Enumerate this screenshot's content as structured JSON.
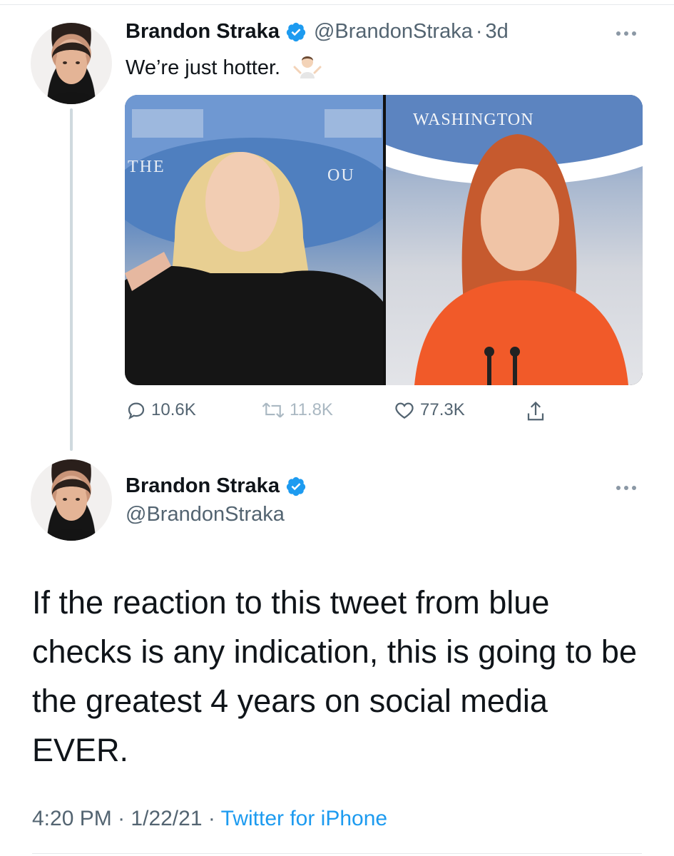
{
  "tweet1": {
    "display_name": "Brandon Straka",
    "handle": "@BrandonStraka",
    "separator": "·",
    "time_ago": "3d",
    "text": "We’re just hotter.",
    "media": {
      "labels": [
        "WASHINGTON",
        "THE",
        "OU"
      ]
    },
    "actions": {
      "replies": "10.6K",
      "retweets": "11.8K",
      "likes": "77.3K"
    }
  },
  "tweet2": {
    "display_name": "Brandon Straka",
    "handle": "@BrandonStraka",
    "text": "If the reaction to this tweet from blue checks is any indication, this is going to be the greatest 4 years on social media EVER.",
    "time": "4:20 PM",
    "separator": "·",
    "date": "1/22/21",
    "source": "Twitter for iPhone"
  },
  "colors": {
    "verified": "#1d9bf0",
    "muted": "#536471",
    "link": "#1d9bf0",
    "thread_line": "#cfd9de"
  }
}
